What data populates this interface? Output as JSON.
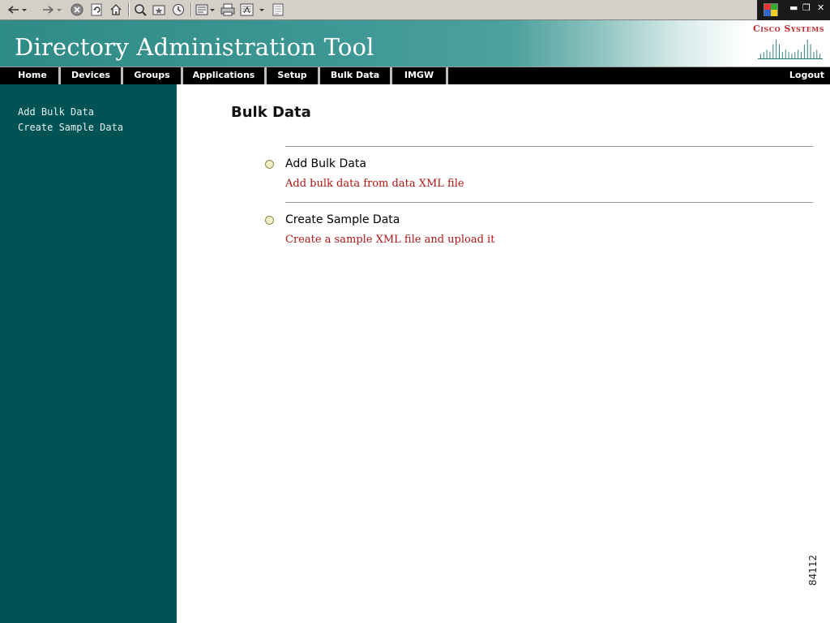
{
  "browser_toolbar": {
    "icons": [
      "back-icon",
      "forward-icon",
      "stop-icon",
      "refresh-icon",
      "home-icon",
      "search-icon",
      "favorites-icon",
      "history-icon",
      "mail-icon",
      "print-icon",
      "edit-icon",
      "discuss-icon"
    ]
  },
  "header": {
    "title": "Directory Administration Tool",
    "logo_text": "Cisco Systems"
  },
  "nav": {
    "items": [
      "Home",
      "Devices",
      "Groups",
      "Applications",
      "Setup",
      "Bulk Data",
      "IMGW"
    ],
    "logout": "Logout"
  },
  "sidebar": {
    "items": [
      "Add Bulk Data",
      "Create Sample Data"
    ]
  },
  "main": {
    "title": "Bulk Data",
    "options": [
      {
        "title": "Add Bulk Data",
        "description": "Add bulk data from data XML file"
      },
      {
        "title": "Create Sample Data",
        "description": "Create a sample XML file and upload it"
      }
    ]
  },
  "figure_number": "84112",
  "colors": {
    "banner": "#3d9794",
    "sidebar": "#005355",
    "nav": "#000000",
    "description": "#b01414",
    "logo_red": "#c0282c"
  }
}
